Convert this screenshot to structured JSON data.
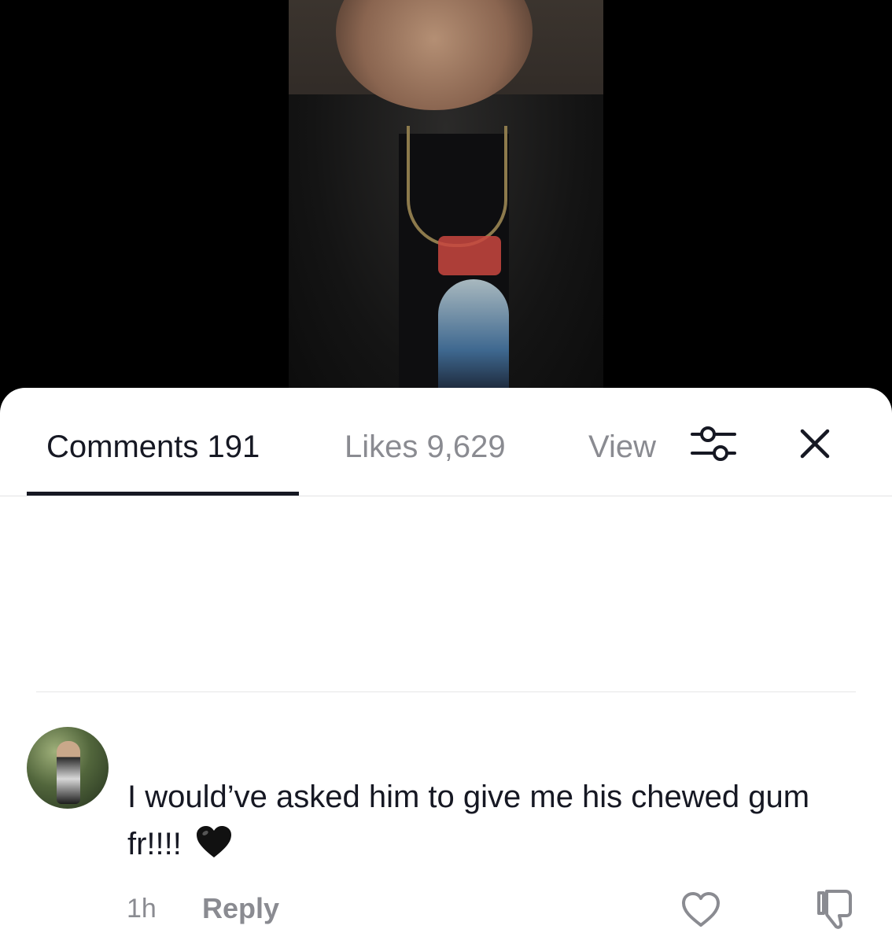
{
  "tabs": {
    "comments": "Comments 191",
    "likes": "Likes 9,629",
    "view": "View"
  },
  "icons": {
    "filter": "sliders-icon",
    "close": "close-icon",
    "like": "heart-outline-icon",
    "dislike": "thumbs-down-icon",
    "emoji": "black-heart-emoji"
  },
  "comment": {
    "text": "I would’ve asked him to give me his chewed gum fr!!!!",
    "time": "1h",
    "reply_label": "Reply"
  },
  "colors": {
    "text_primary": "#161823",
    "text_secondary": "#8a8b91",
    "tab_indicator": "#161823"
  }
}
